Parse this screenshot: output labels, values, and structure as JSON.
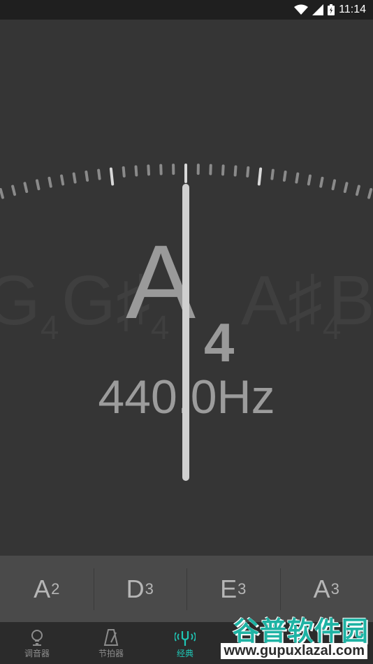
{
  "status_bar": {
    "time": "11:14"
  },
  "tuner": {
    "ghost_notes": [
      {
        "letter": "G",
        "sub": "4"
      },
      {
        "letter": "G♯",
        "sub": "4"
      },
      {
        "letter": "A♯",
        "sub": "4"
      },
      {
        "letter": "B",
        "sub": ""
      }
    ],
    "note": "A",
    "octave": "4",
    "frequency": "440.0Hz"
  },
  "strings": [
    {
      "note": "A",
      "octave": "2"
    },
    {
      "note": "D",
      "octave": "3"
    },
    {
      "note": "E",
      "octave": "3"
    },
    {
      "note": "A",
      "octave": "3"
    }
  ],
  "nav": [
    {
      "label": "调音器",
      "icon": "pin-icon"
    },
    {
      "label": "节拍器",
      "icon": "metronome-icon"
    },
    {
      "label": "经典",
      "icon": "tuning-fork-icon",
      "active": true
    }
  ],
  "watermark": {
    "title": "谷普软件园",
    "url": "www.gupuxlazal.com"
  },
  "colors": {
    "accent": "#1fc6b5",
    "background": "#353535"
  }
}
